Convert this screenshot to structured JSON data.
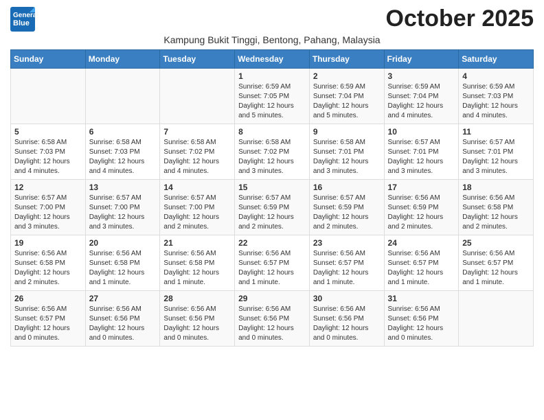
{
  "logo": {
    "line1": "General",
    "line2": "Blue"
  },
  "title": "October 2025",
  "location": "Kampung Bukit Tinggi, Bentong, Pahang, Malaysia",
  "weekdays": [
    "Sunday",
    "Monday",
    "Tuesday",
    "Wednesday",
    "Thursday",
    "Friday",
    "Saturday"
  ],
  "weeks": [
    [
      {
        "day": "",
        "info": ""
      },
      {
        "day": "",
        "info": ""
      },
      {
        "day": "",
        "info": ""
      },
      {
        "day": "1",
        "info": "Sunrise: 6:59 AM\nSunset: 7:05 PM\nDaylight: 12 hours\nand 5 minutes."
      },
      {
        "day": "2",
        "info": "Sunrise: 6:59 AM\nSunset: 7:04 PM\nDaylight: 12 hours\nand 5 minutes."
      },
      {
        "day": "3",
        "info": "Sunrise: 6:59 AM\nSunset: 7:04 PM\nDaylight: 12 hours\nand 4 minutes."
      },
      {
        "day": "4",
        "info": "Sunrise: 6:59 AM\nSunset: 7:03 PM\nDaylight: 12 hours\nand 4 minutes."
      }
    ],
    [
      {
        "day": "5",
        "info": "Sunrise: 6:58 AM\nSunset: 7:03 PM\nDaylight: 12 hours\nand 4 minutes."
      },
      {
        "day": "6",
        "info": "Sunrise: 6:58 AM\nSunset: 7:03 PM\nDaylight: 12 hours\nand 4 minutes."
      },
      {
        "day": "7",
        "info": "Sunrise: 6:58 AM\nSunset: 7:02 PM\nDaylight: 12 hours\nand 4 minutes."
      },
      {
        "day": "8",
        "info": "Sunrise: 6:58 AM\nSunset: 7:02 PM\nDaylight: 12 hours\nand 3 minutes."
      },
      {
        "day": "9",
        "info": "Sunrise: 6:58 AM\nSunset: 7:01 PM\nDaylight: 12 hours\nand 3 minutes."
      },
      {
        "day": "10",
        "info": "Sunrise: 6:57 AM\nSunset: 7:01 PM\nDaylight: 12 hours\nand 3 minutes."
      },
      {
        "day": "11",
        "info": "Sunrise: 6:57 AM\nSunset: 7:01 PM\nDaylight: 12 hours\nand 3 minutes."
      }
    ],
    [
      {
        "day": "12",
        "info": "Sunrise: 6:57 AM\nSunset: 7:00 PM\nDaylight: 12 hours\nand 3 minutes."
      },
      {
        "day": "13",
        "info": "Sunrise: 6:57 AM\nSunset: 7:00 PM\nDaylight: 12 hours\nand 3 minutes."
      },
      {
        "day": "14",
        "info": "Sunrise: 6:57 AM\nSunset: 7:00 PM\nDaylight: 12 hours\nand 2 minutes."
      },
      {
        "day": "15",
        "info": "Sunrise: 6:57 AM\nSunset: 6:59 PM\nDaylight: 12 hours\nand 2 minutes."
      },
      {
        "day": "16",
        "info": "Sunrise: 6:57 AM\nSunset: 6:59 PM\nDaylight: 12 hours\nand 2 minutes."
      },
      {
        "day": "17",
        "info": "Sunrise: 6:56 AM\nSunset: 6:59 PM\nDaylight: 12 hours\nand 2 minutes."
      },
      {
        "day": "18",
        "info": "Sunrise: 6:56 AM\nSunset: 6:58 PM\nDaylight: 12 hours\nand 2 minutes."
      }
    ],
    [
      {
        "day": "19",
        "info": "Sunrise: 6:56 AM\nSunset: 6:58 PM\nDaylight: 12 hours\nand 2 minutes."
      },
      {
        "day": "20",
        "info": "Sunrise: 6:56 AM\nSunset: 6:58 PM\nDaylight: 12 hours\nand 1 minute."
      },
      {
        "day": "21",
        "info": "Sunrise: 6:56 AM\nSunset: 6:58 PM\nDaylight: 12 hours\nand 1 minute."
      },
      {
        "day": "22",
        "info": "Sunrise: 6:56 AM\nSunset: 6:57 PM\nDaylight: 12 hours\nand 1 minute."
      },
      {
        "day": "23",
        "info": "Sunrise: 6:56 AM\nSunset: 6:57 PM\nDaylight: 12 hours\nand 1 minute."
      },
      {
        "day": "24",
        "info": "Sunrise: 6:56 AM\nSunset: 6:57 PM\nDaylight: 12 hours\nand 1 minute."
      },
      {
        "day": "25",
        "info": "Sunrise: 6:56 AM\nSunset: 6:57 PM\nDaylight: 12 hours\nand 1 minute."
      }
    ],
    [
      {
        "day": "26",
        "info": "Sunrise: 6:56 AM\nSunset: 6:57 PM\nDaylight: 12 hours\nand 0 minutes."
      },
      {
        "day": "27",
        "info": "Sunrise: 6:56 AM\nSunset: 6:56 PM\nDaylight: 12 hours\nand 0 minutes."
      },
      {
        "day": "28",
        "info": "Sunrise: 6:56 AM\nSunset: 6:56 PM\nDaylight: 12 hours\nand 0 minutes."
      },
      {
        "day": "29",
        "info": "Sunrise: 6:56 AM\nSunset: 6:56 PM\nDaylight: 12 hours\nand 0 minutes."
      },
      {
        "day": "30",
        "info": "Sunrise: 6:56 AM\nSunset: 6:56 PM\nDaylight: 12 hours\nand 0 minutes."
      },
      {
        "day": "31",
        "info": "Sunrise: 6:56 AM\nSunset: 6:56 PM\nDaylight: 12 hours\nand 0 minutes."
      },
      {
        "day": "",
        "info": ""
      }
    ]
  ]
}
